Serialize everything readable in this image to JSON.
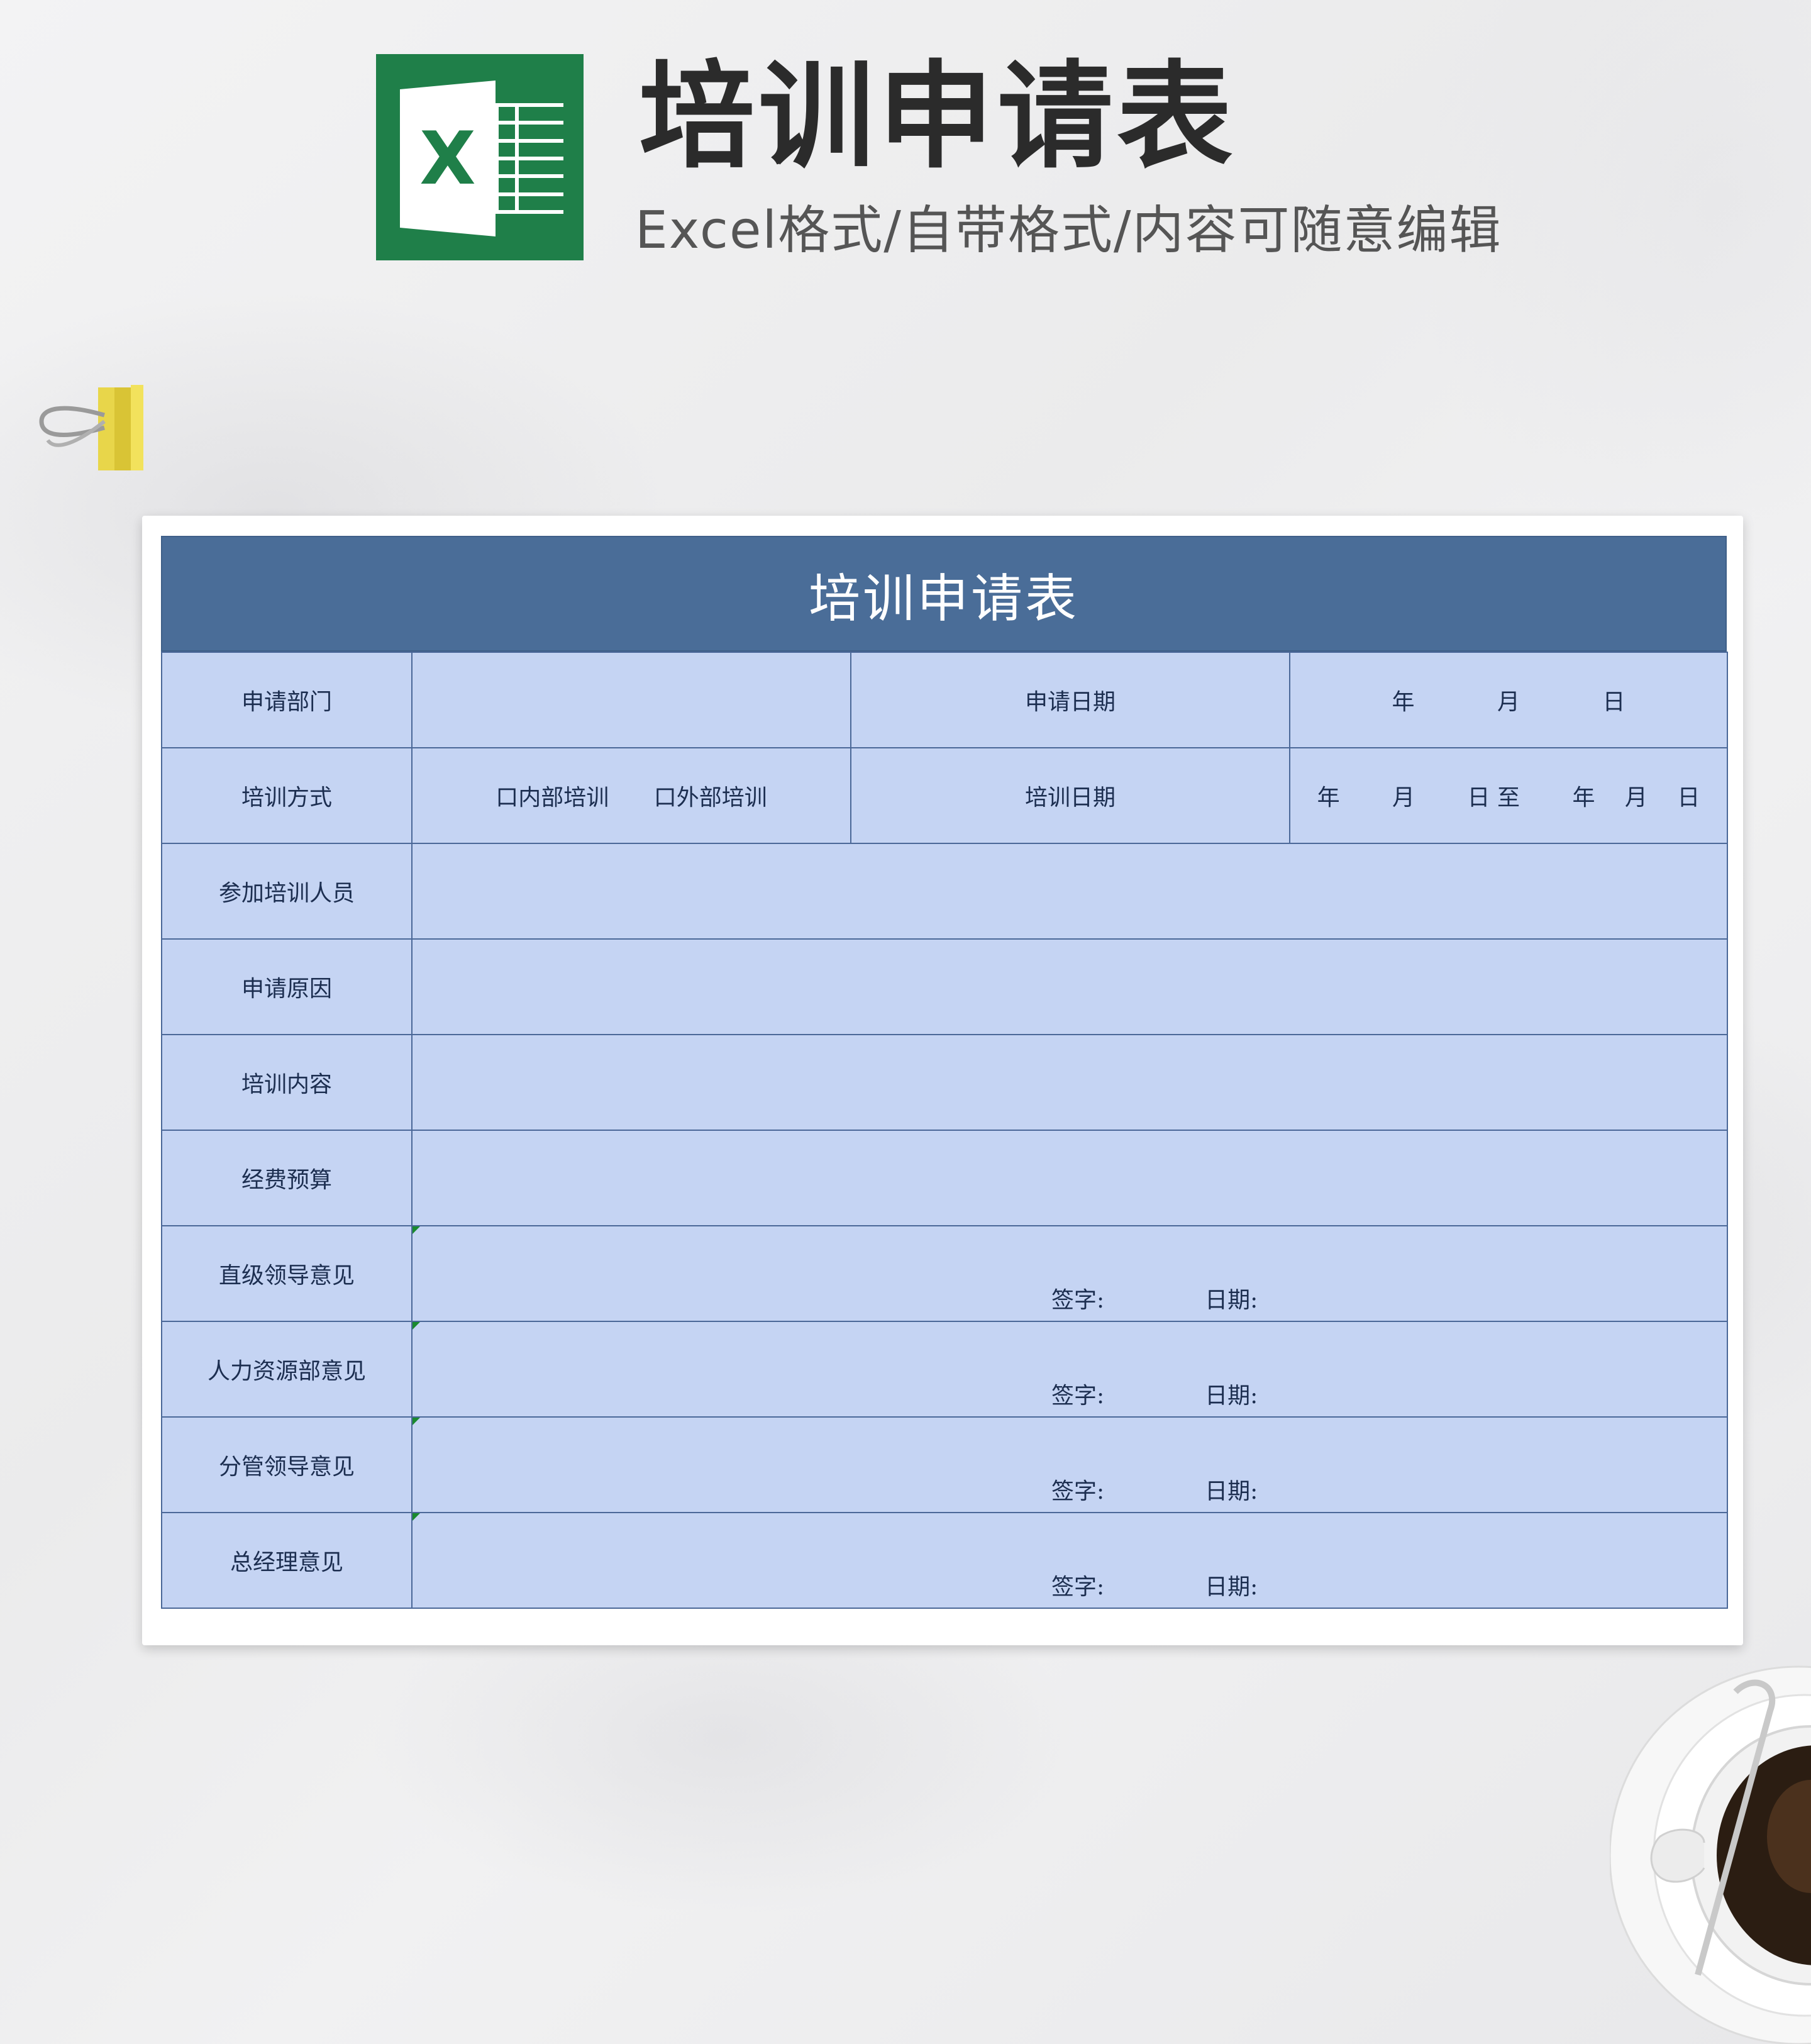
{
  "header": {
    "title": "培训申请表",
    "subtitle": "Excel格式/自带格式/内容可随意编辑",
    "logo_letter": "X",
    "logo_color": "#1f7f49"
  },
  "form": {
    "title": "培训申请表",
    "header_color": "#4a6d98",
    "cell_color": "#c5d4f3",
    "row1": {
      "dept_label": "申请部门",
      "dept_value": "",
      "date_label": "申请日期",
      "date_year": "年",
      "date_month": "月",
      "date_day": "日"
    },
    "row2": {
      "method_label": "培训方式",
      "option_internal": "口内部培训",
      "option_external": "口外部培训",
      "date_label": "培训日期",
      "date_range": {
        "y1": "年",
        "m1": "月",
        "d1": "日",
        "to": "至",
        "y2": "年",
        "m2": "月",
        "d2": "日"
      }
    },
    "rows": [
      {
        "label": "参加培训人员",
        "value": ""
      },
      {
        "label": "申请原因",
        "value": ""
      },
      {
        "label": "培训内容",
        "value": ""
      },
      {
        "label": "经费预算",
        "value": ""
      }
    ],
    "approvals": [
      {
        "label": "直级领导意见",
        "sign": "签字:",
        "date": "日期:"
      },
      {
        "label": "人力资源部意见",
        "sign": "签字:",
        "date": "日期:"
      },
      {
        "label": "分管领导意见",
        "sign": "签字:",
        "date": "日期:"
      },
      {
        "label": "总经理意见",
        "sign": "签字:",
        "date": "日期:"
      }
    ]
  }
}
